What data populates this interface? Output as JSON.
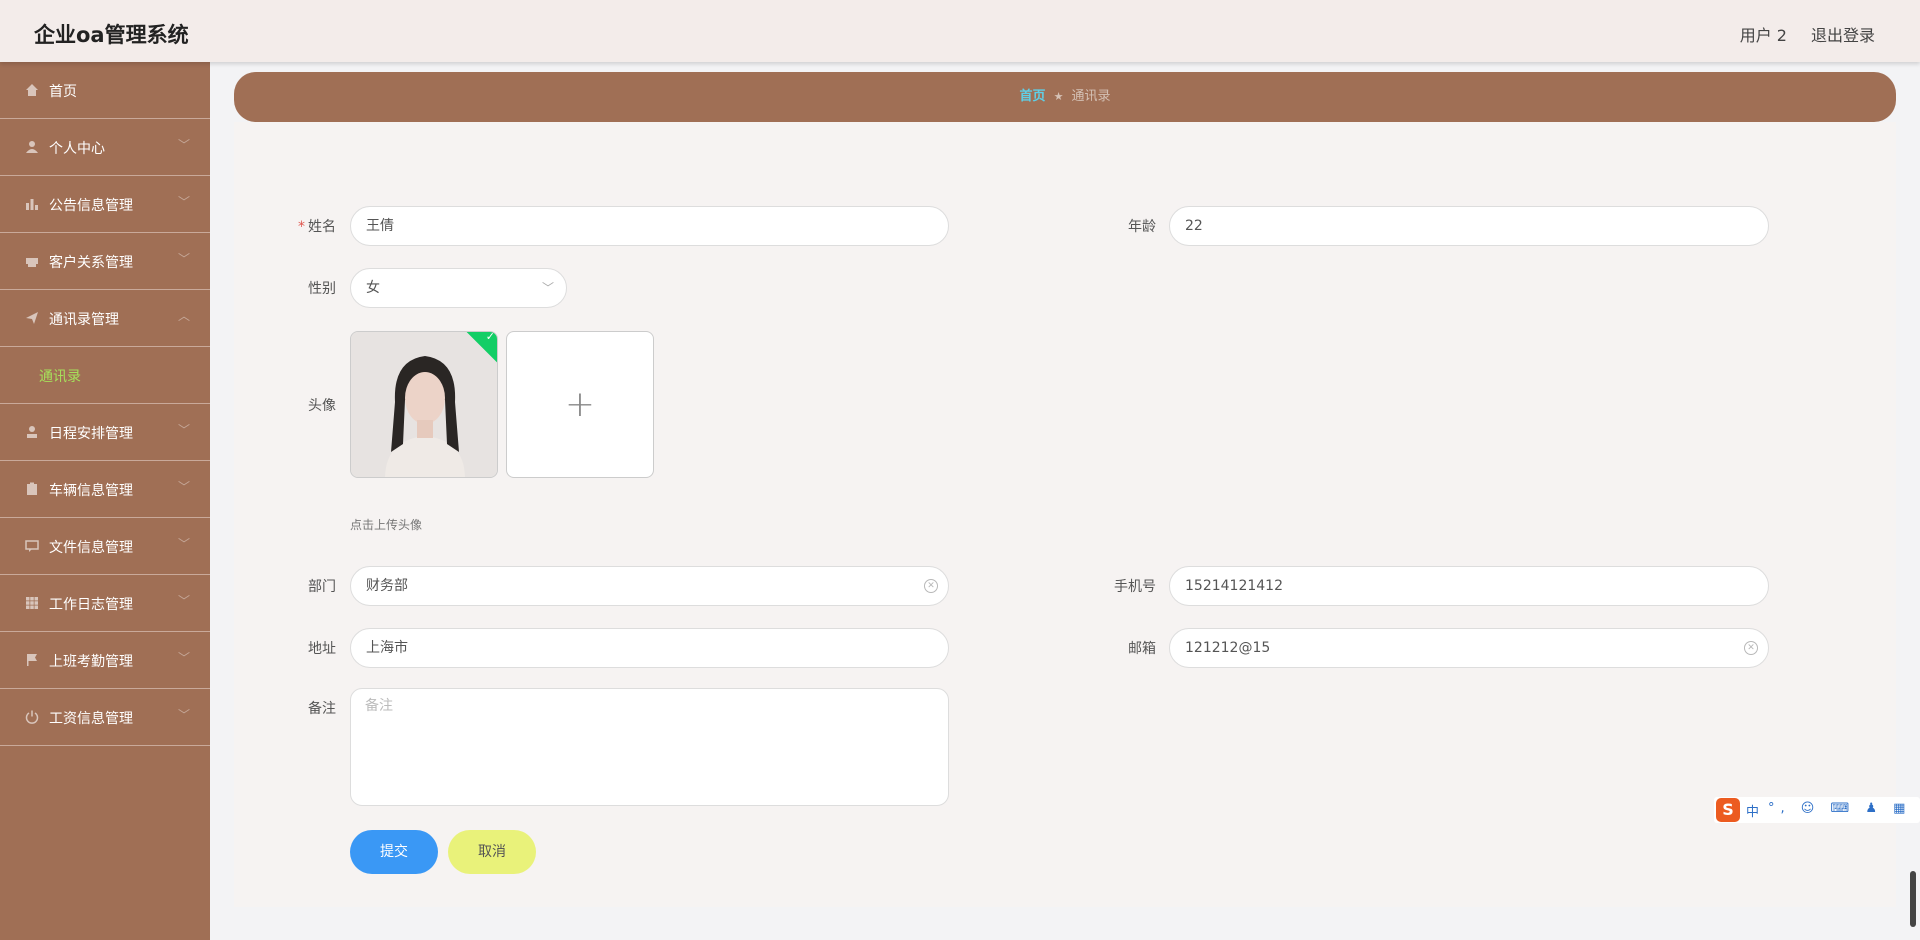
{
  "header": {
    "brand": "企业oa管理系统",
    "user": "用户 2",
    "logout": "退出登录"
  },
  "sidebar": {
    "items": [
      {
        "label": "首页",
        "icon": "home-icon"
      },
      {
        "label": "个人中心",
        "icon": "user-icon"
      },
      {
        "label": "公告信息管理",
        "icon": "bar-chart-icon"
      },
      {
        "label": "客户关系管理",
        "icon": "printer-icon"
      },
      {
        "label": "通讯录管理",
        "icon": "send-icon",
        "expanded": true,
        "sub": "通讯录"
      },
      {
        "label": "日程安排管理",
        "icon": "person-icon"
      },
      {
        "label": "车辆信息管理",
        "icon": "clipboard-icon"
      },
      {
        "label": "文件信息管理",
        "icon": "chat-icon"
      },
      {
        "label": "工作日志管理",
        "icon": "grid-icon"
      },
      {
        "label": "上班考勤管理",
        "icon": "flag-icon"
      },
      {
        "label": "工资信息管理",
        "icon": "power-icon"
      }
    ],
    "active_sub": "通讯录"
  },
  "breadcrumb": {
    "home": "首页",
    "current": "通讯录"
  },
  "form": {
    "name": {
      "label": "姓名",
      "value": "王倩"
    },
    "age": {
      "label": "年龄",
      "value": "22"
    },
    "gender": {
      "label": "性别",
      "value": "女"
    },
    "avatar": {
      "label": "头像",
      "tip": "点击上传头像"
    },
    "department": {
      "label": "部门",
      "value": "财务部"
    },
    "phone": {
      "label": "手机号",
      "value": "15214121412"
    },
    "address": {
      "label": "地址",
      "value": "上海市"
    },
    "email": {
      "label": "邮箱",
      "value": "121212@15"
    },
    "remark": {
      "label": "备注",
      "placeholder": "备注"
    },
    "submit": "提交",
    "cancel": "取消"
  },
  "ime": {
    "logo": "S",
    "mode": "中",
    "extra": "°, ☺ ⌨ ♟ ▦"
  },
  "colors": {
    "sidebar": "#a06f55",
    "submit": "#3a98f5",
    "cancel": "#e9f27a",
    "active_sub": "#a6e05a"
  }
}
